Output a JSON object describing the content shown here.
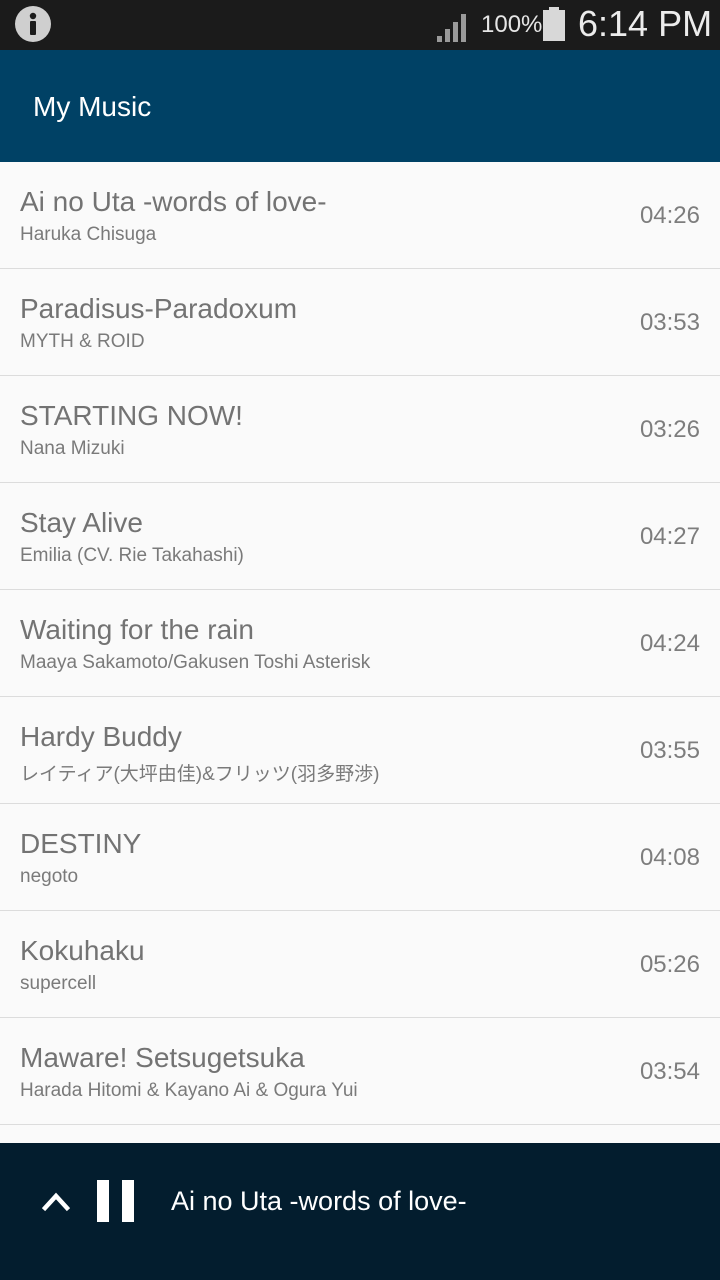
{
  "status_bar": {
    "battery_percent": "100%",
    "time": "6:14 PM",
    "icons": [
      "info-icon",
      "signal-icon",
      "battery-icon"
    ]
  },
  "app_bar": {
    "title": "My Music"
  },
  "songs": [
    {
      "title": "Ai no Uta -words of love-",
      "artist": "Haruka Chisuga",
      "duration": "04:26"
    },
    {
      "title": "Paradisus-Paradoxum",
      "artist": "MYTH & ROID",
      "duration": "03:53"
    },
    {
      "title": "STARTING NOW!",
      "artist": "Nana Mizuki",
      "duration": "03:26"
    },
    {
      "title": "Stay Alive",
      "artist": "Emilia (CV. Rie Takahashi)",
      "duration": "04:27"
    },
    {
      "title": "Waiting for the rain",
      "artist": "Maaya Sakamoto/Gakusen Toshi Asterisk",
      "duration": "04:24"
    },
    {
      "title": "Hardy Buddy",
      "artist": "レイティア(大坪由佳)&フリッツ(羽多野渉)",
      "duration": "03:55"
    },
    {
      "title": "DESTINY",
      "artist": "negoto",
      "duration": "04:08"
    },
    {
      "title": "Kokuhaku",
      "artist": "supercell",
      "duration": "05:26"
    },
    {
      "title": "Maware! Setsugetsuka",
      "artist": "Harada Hitomi & Kayano Ai & Ogura Yui",
      "duration": "03:54"
    }
  ],
  "now_playing": {
    "title": "Ai no Uta -words of love-",
    "state": "playing",
    "icons": [
      "chevron-up-icon",
      "pause-icon"
    ]
  },
  "colors": {
    "status_bar": "#1b1b1b",
    "app_bar": "#004165",
    "player_bar": "#031d2e",
    "list_background": "#fafafa",
    "divider": "#dcdcdc"
  }
}
